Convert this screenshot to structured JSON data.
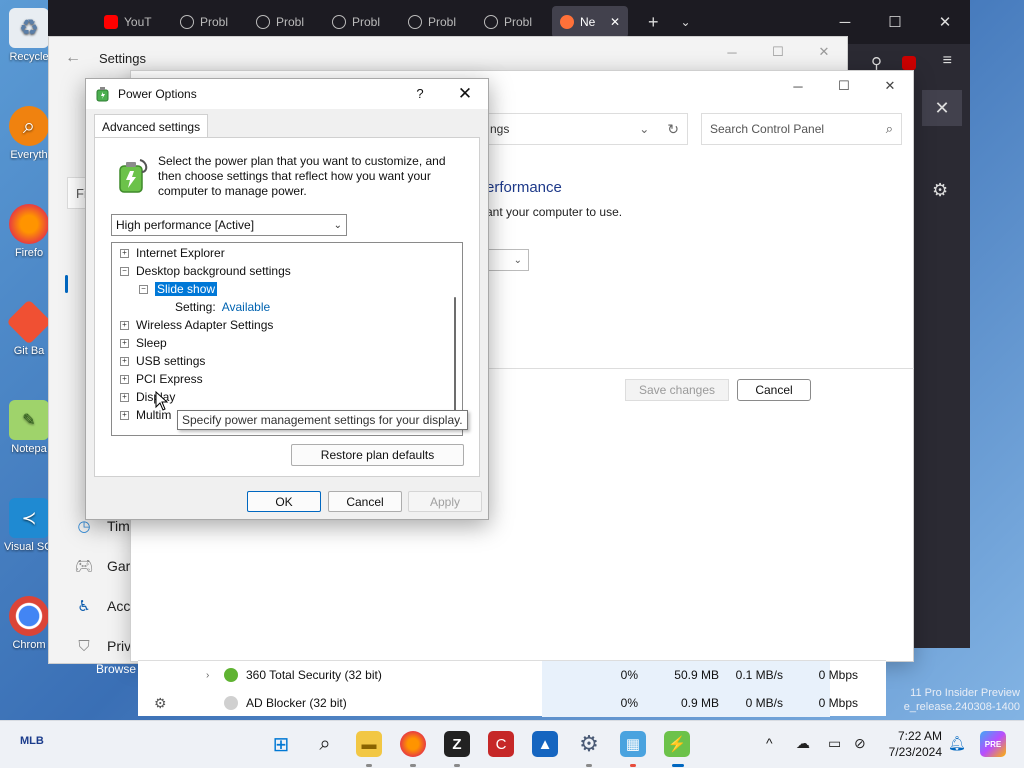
{
  "desktop": {
    "icons": [
      {
        "label": "Recycle"
      },
      {
        "label": "Everyth"
      },
      {
        "label": "Firefo"
      },
      {
        "label": "Git Ba"
      },
      {
        "label": "Notepa"
      },
      {
        "label": "Visual S​Cod"
      },
      {
        "label": "Chrom"
      }
    ]
  },
  "browser": {
    "tabs": [
      {
        "label": "YouT"
      },
      {
        "label": "Probl"
      },
      {
        "label": "Probl"
      },
      {
        "label": "Probl"
      },
      {
        "label": "Probl"
      },
      {
        "label": "Probl"
      },
      {
        "label": "Ne"
      }
    ],
    "partial_label": "Browse"
  },
  "settings_app": {
    "title": "Settings",
    "nav": [
      {
        "label": "Fi"
      },
      {
        "label": "Tim"
      },
      {
        "label": "Gar"
      },
      {
        "label": "Acc"
      },
      {
        "label": "Priv"
      }
    ]
  },
  "control_panel": {
    "address_text": "ngs",
    "search_placeholder": "Search Control Panel",
    "heading": "erformance",
    "subtext": "ant your computer to use.",
    "save_changes": "Save changes",
    "cancel": "Cancel"
  },
  "task_manager": {
    "rows": [
      {
        "name": "360 Total Security (32 bit)",
        "cpu": "0%",
        "memory": "50.9 MB",
        "disk": "0.1 MB/s",
        "network": "0 Mbps"
      },
      {
        "name": "AD Blocker (32 bit)",
        "cpu": "0%",
        "memory": "0.9 MB",
        "disk": "0 MB/s",
        "network": "0 Mbps"
      }
    ]
  },
  "watermark": {
    "line1": "11 Pro Insider Preview",
    "line2": "e_release.240308-1400"
  },
  "dialog": {
    "title": "Power Options",
    "help": "?",
    "tab": "Advanced settings",
    "intro": "Select the power plan that you want to customize, and then choose settings that reflect how you want your computer to manage power.",
    "plan": "High performance [Active]",
    "tree": {
      "internet_explorer": "Internet Explorer",
      "desktop_background": "Desktop background settings",
      "slide_show": "Slide show",
      "setting_label": "Setting:",
      "setting_value": "Available",
      "wireless": "Wireless Adapter Settings",
      "sleep": "Sleep",
      "usb": "USB settings",
      "pci": "PCI Express",
      "display": "Display",
      "multimedia": "Multim"
    },
    "tooltip": "Specify power management settings for your display.",
    "restore": "Restore plan defaults",
    "ok": "OK",
    "cancel": "Cancel",
    "apply": "Apply"
  },
  "taskbar": {
    "left_label": "MLB",
    "time": "7:22 AM",
    "date": "7/23/2024"
  },
  "colors": {
    "accent": "#0078d7",
    "link": "#0063b1",
    "heading": "#1e3a8a"
  }
}
